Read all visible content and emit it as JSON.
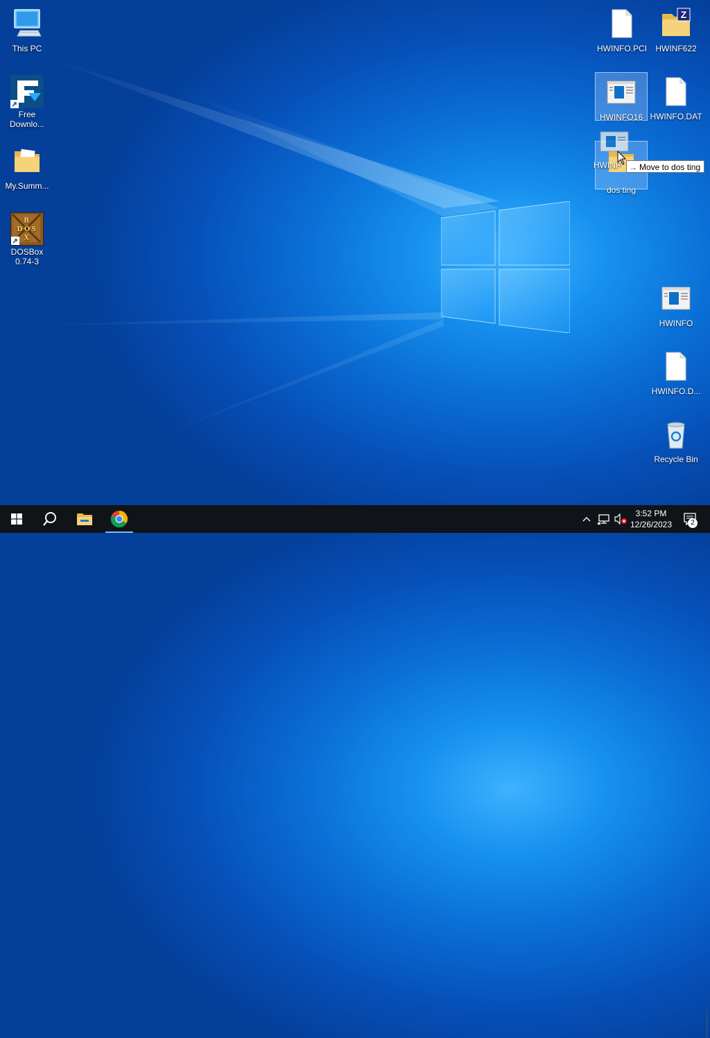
{
  "desktop": {
    "left_icons": [
      {
        "label": "This PC",
        "icon": "computer-icon"
      },
      {
        "label": "Free Downlo...",
        "icon": "free-download-manager-icon",
        "shortcut": true
      },
      {
        "label": "My.Summ...",
        "icon": "folder-icon"
      },
      {
        "label": "DOSBox 0.74-3",
        "icon": "dosbox-icon",
        "shortcut": true
      }
    ],
    "right_icons": [
      {
        "label": "HWINFO.PCI",
        "icon": "file-icon"
      },
      {
        "label": "HWINF622",
        "icon": "zip-folder-icon"
      },
      {
        "label": "HWINFO16",
        "icon": "app-window-icon",
        "selected": true
      },
      {
        "label": "HWINFO.DAT",
        "icon": "file-icon"
      },
      {
        "label": "dos ting",
        "icon": "folder-icon",
        "selected": true
      },
      {
        "label": "HWINFO",
        "icon": "app-window-icon"
      },
      {
        "label": "HWINFO.D...",
        "icon": "file-icon"
      },
      {
        "label": "Recycle Bin",
        "icon": "recycle-bin-icon"
      }
    ],
    "drag": {
      "ghost_label": "HWINFO16",
      "tooltip_arrow": "→",
      "tooltip_text": "Move to dos ting"
    }
  },
  "taskbar": {
    "pinned": [
      {
        "name": "start-button",
        "icon": "windows-logo-icon"
      },
      {
        "name": "search-button",
        "icon": "search-icon"
      },
      {
        "name": "file-explorer-button",
        "icon": "folder-icon"
      },
      {
        "name": "chrome-button",
        "icon": "chrome-icon",
        "active": true
      }
    ],
    "tray": {
      "chevron": "^",
      "time": "3:52 PM",
      "date": "12/26/2023",
      "notification_count": "2"
    }
  },
  "colors": {
    "taskbar": "#101418",
    "accent": "#0078d7",
    "folder": "#f4d06b"
  }
}
